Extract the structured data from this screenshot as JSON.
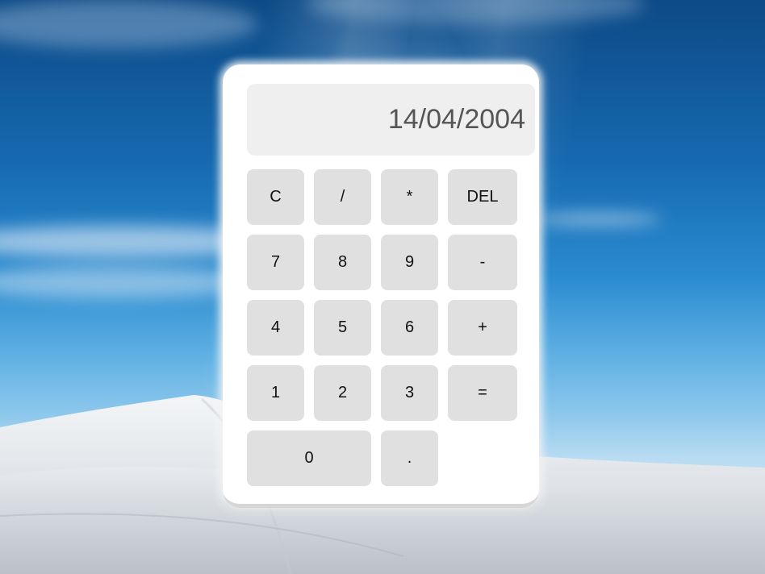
{
  "calculator": {
    "display_value": "14/04/2004",
    "keys": {
      "clear": "C",
      "divide": "/",
      "multiply": "*",
      "delete": "DEL",
      "seven": "7",
      "eight": "8",
      "nine": "9",
      "minus": "-",
      "four": "4",
      "five": "5",
      "six": "6",
      "plus": "+",
      "one": "1",
      "two": "2",
      "three": "3",
      "equals": "=",
      "zero": "0",
      "decimal": "."
    }
  },
  "colors": {
    "sky_top": "#0d4a86",
    "sky_mid": "#2a8bd0",
    "panel": "#ffffff",
    "display_bg": "#efefef",
    "key_bg": "#e0e0e0",
    "display_text": "#555555"
  }
}
